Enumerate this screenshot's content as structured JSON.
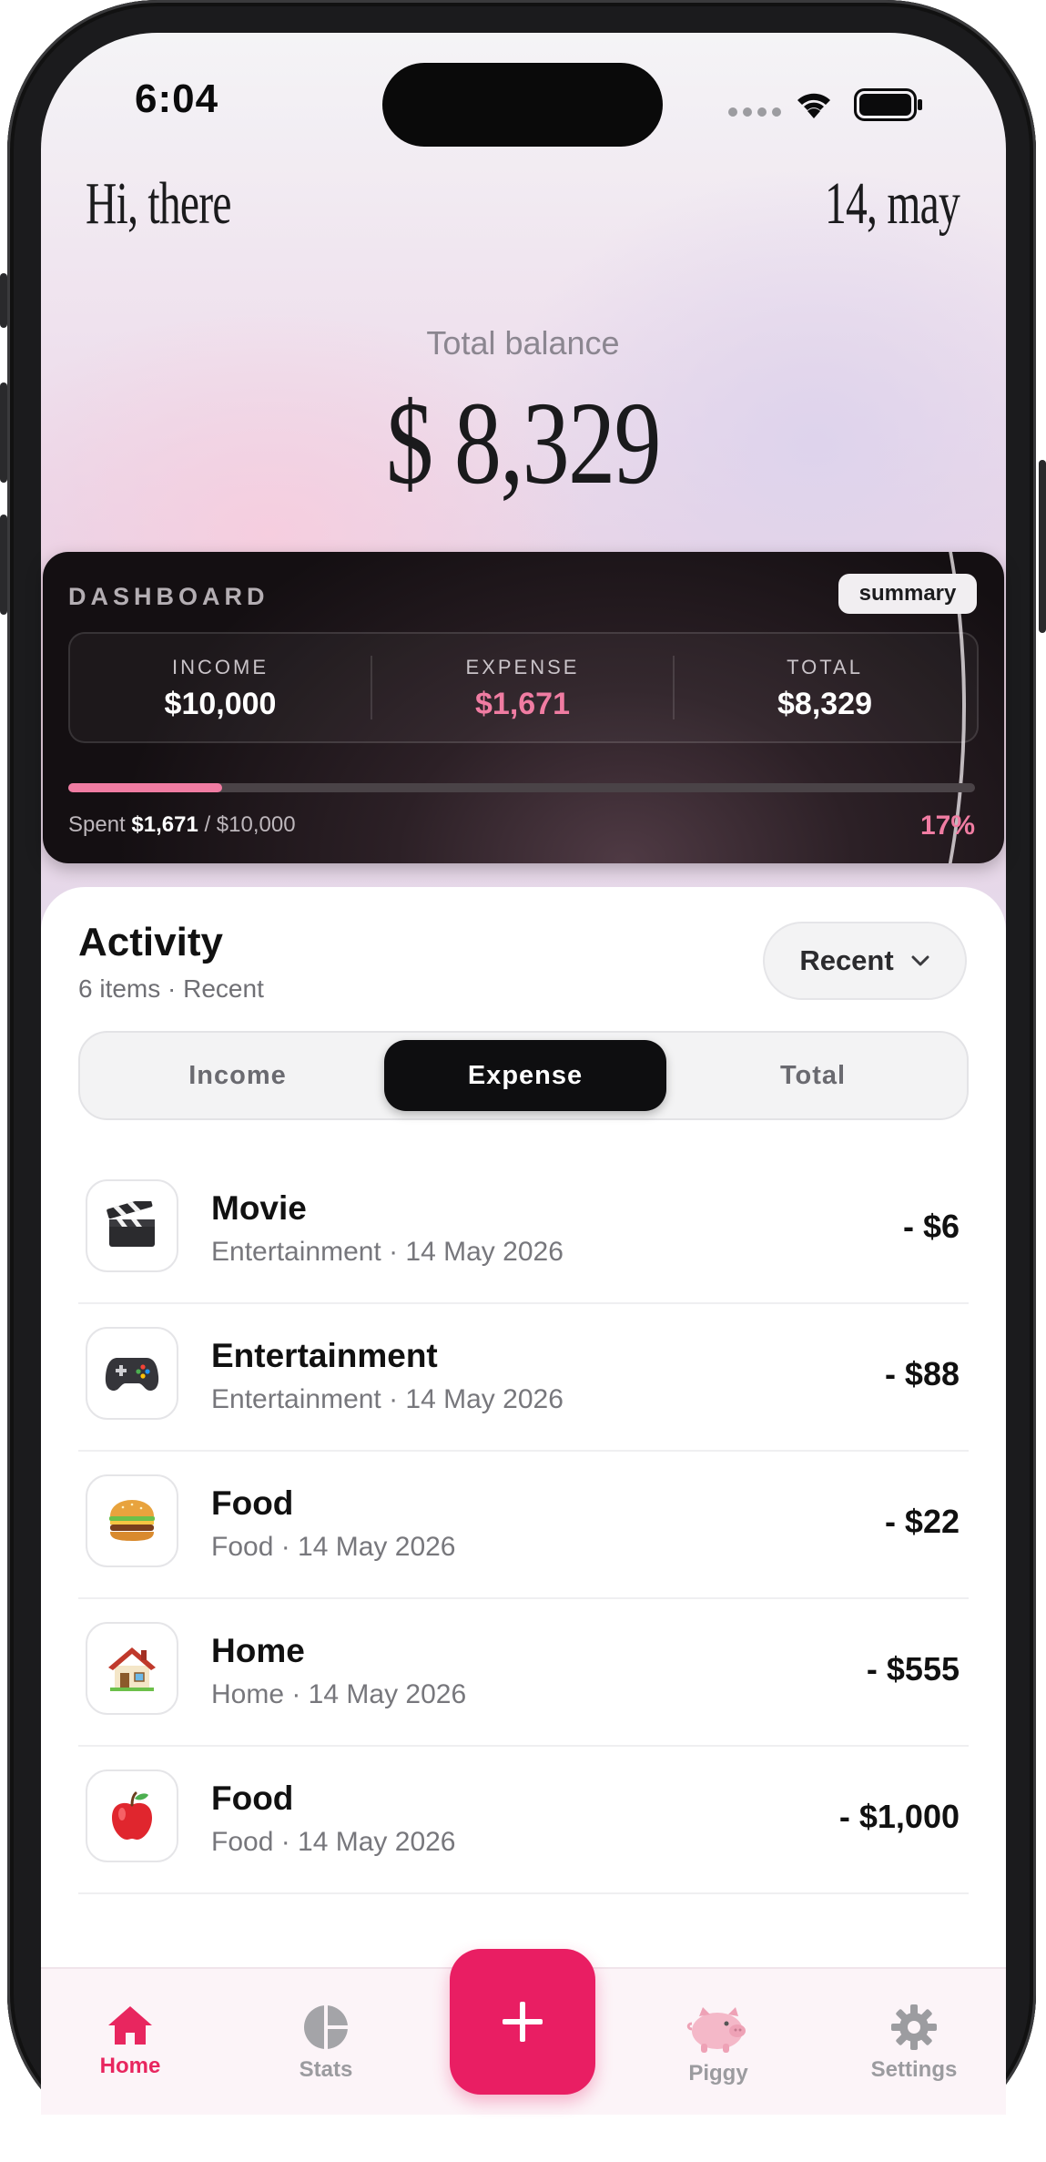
{
  "status_bar": {
    "time": "6:04"
  },
  "header": {
    "greeting": "Hi, there",
    "date": "14, may",
    "total_label": "Total balance",
    "total_value": "$ 8,329"
  },
  "dashboard": {
    "title": "DASHBOARD",
    "badge": "summary",
    "stats": [
      {
        "label": "INCOME",
        "value": "$10,000",
        "color": "#ffffff"
      },
      {
        "label": "EXPENSE",
        "value": "$1,671",
        "color": "#f07ca2"
      },
      {
        "label": "TOTAL",
        "value": "$8,329",
        "color": "#ffffff"
      }
    ],
    "progress_fraction": 0.17,
    "spent_prefix": "Spent",
    "spent_amount": "$1,671",
    "spent_suffix": "/ $10,000",
    "percent": "17%",
    "accent_color": "#f07ca2"
  },
  "activity": {
    "title": "Activity",
    "subtitle": "6 items · Recent",
    "sort_label": "Recent",
    "segments": [
      "Income",
      "Expense",
      "Total"
    ],
    "active_segment": "Expense",
    "items": [
      {
        "icon": "clapper-board-icon",
        "emoji": "🎬",
        "name": "Movie",
        "meta": "Entertainment · 14 May 2026",
        "amount": "- $6"
      },
      {
        "icon": "gamepad-icon",
        "emoji": "🎮",
        "name": "Entertainment",
        "meta": "Entertainment · 14 May 2026",
        "amount": "- $88"
      },
      {
        "icon": "burger-icon",
        "emoji": "🍔",
        "name": "Food",
        "meta": "Food · 14 May 2026",
        "amount": "- $22"
      },
      {
        "icon": "house-icon",
        "emoji": "🏠",
        "name": "Home",
        "meta": "Home · 14 May 2026",
        "amount": "- $555"
      },
      {
        "icon": "apple-icon",
        "emoji": "🍎",
        "name": "Food",
        "meta": "Food · 14 May 2026",
        "amount": "- $1,000"
      }
    ]
  },
  "tabbar": {
    "tabs": [
      {
        "label": "Home",
        "icon": "house-icon",
        "active": true
      },
      {
        "label": "Stats",
        "icon": "pie-chart-icon",
        "active": false
      },
      {
        "label": "Piggy",
        "icon": "pig-icon",
        "active": false
      },
      {
        "label": "Settings",
        "icon": "gear-icon",
        "active": false
      }
    ],
    "add_icon": "plus-icon",
    "accent_color": "#e91e63"
  }
}
